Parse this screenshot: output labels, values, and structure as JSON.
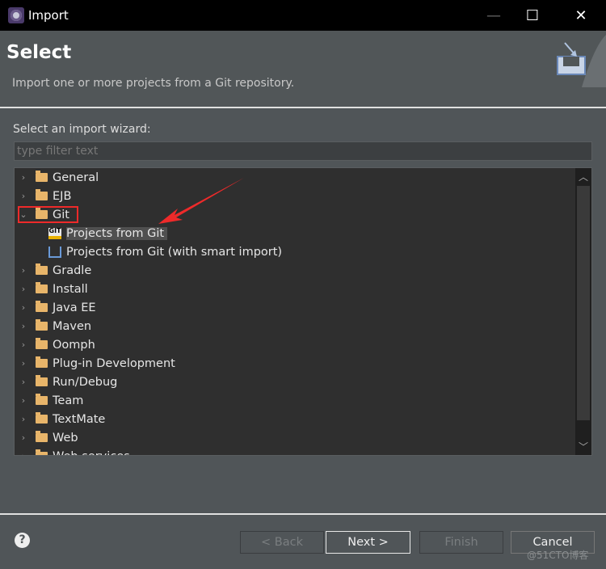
{
  "window": {
    "title": "Import",
    "minimize": "—",
    "maximize": "☐",
    "close": "✕"
  },
  "header": {
    "title": "Select",
    "description": "Import one or more projects from a Git repository."
  },
  "wizard": {
    "label": "Select an import wizard:",
    "filter_placeholder": "type filter text",
    "filter_value": ""
  },
  "tree": [
    {
      "label": "General",
      "type": "folder",
      "expanded": false
    },
    {
      "label": "EJB",
      "type": "folder",
      "expanded": false
    },
    {
      "label": "Git",
      "type": "folder",
      "expanded": true
    },
    {
      "label": "Projects from Git",
      "type": "git-wizard",
      "child": true,
      "selected": true
    },
    {
      "label": "Projects from Git (with smart import)",
      "type": "smart-import",
      "child": true
    },
    {
      "label": "Gradle",
      "type": "folder",
      "expanded": false
    },
    {
      "label": "Install",
      "type": "folder",
      "expanded": false
    },
    {
      "label": "Java EE",
      "type": "folder",
      "expanded": false
    },
    {
      "label": "Maven",
      "type": "folder",
      "expanded": false
    },
    {
      "label": "Oomph",
      "type": "folder",
      "expanded": false
    },
    {
      "label": "Plug-in Development",
      "type": "folder",
      "expanded": false
    },
    {
      "label": "Run/Debug",
      "type": "folder",
      "expanded": false
    },
    {
      "label": "Team",
      "type": "folder",
      "expanded": false
    },
    {
      "label": "TextMate",
      "type": "folder",
      "expanded": false
    },
    {
      "label": "Web",
      "type": "folder",
      "expanded": false
    },
    {
      "label": "Web services",
      "type": "folder",
      "expanded": false
    }
  ],
  "buttons": {
    "back": "< Back",
    "next": "Next >",
    "finish": "Finish",
    "cancel": "Cancel",
    "help": "?"
  },
  "watermark": "@51CTO博客",
  "colors": {
    "annotation": "#ee2a2a",
    "background": "#505558",
    "tree_bg": "#2f2f2f"
  }
}
